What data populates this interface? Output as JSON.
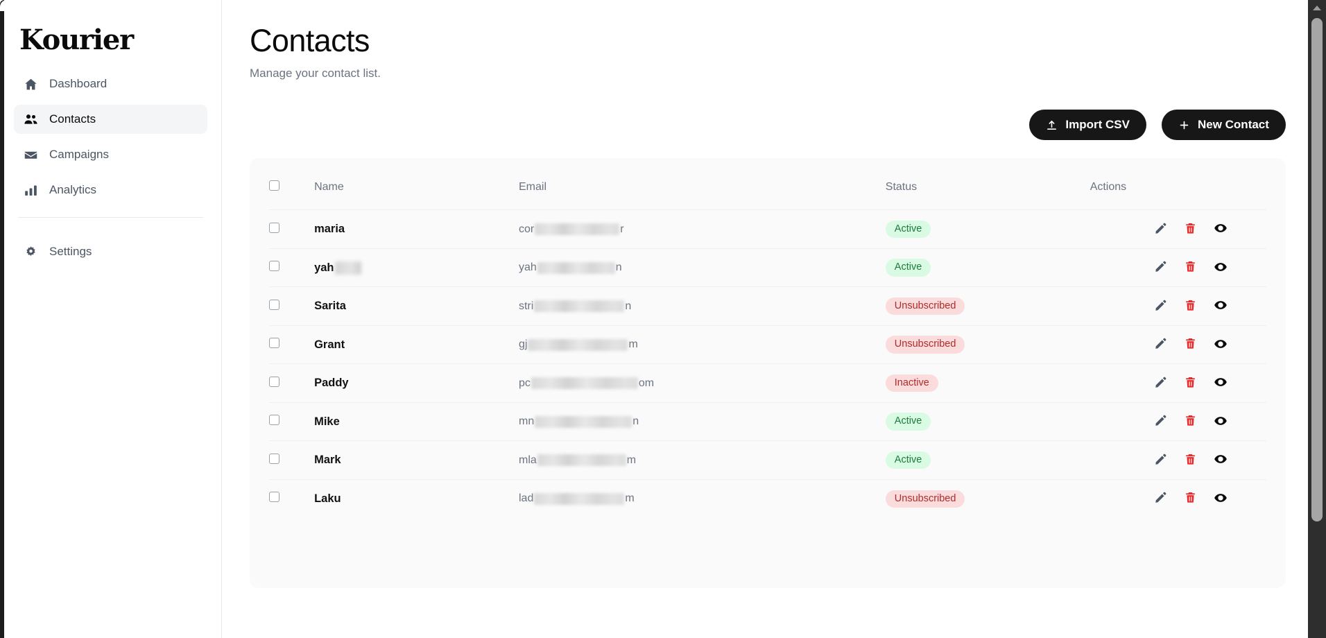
{
  "app": {
    "brand": "Kourier"
  },
  "sidebar": {
    "items": [
      {
        "label": "Dashboard",
        "icon": "home-icon",
        "active": false
      },
      {
        "label": "Contacts",
        "icon": "users-icon",
        "active": true
      },
      {
        "label": "Campaigns",
        "icon": "envelope-icon",
        "active": false
      },
      {
        "label": "Analytics",
        "icon": "bar-chart-icon",
        "active": false
      }
    ],
    "footer_items": [
      {
        "label": "Settings",
        "icon": "gear-icon",
        "active": false
      }
    ]
  },
  "header": {
    "title": "Contacts",
    "subtitle": "Manage your contact list."
  },
  "toolbar": {
    "import_label": "Import CSV",
    "import_icon": "upload-icon",
    "new_contact_label": "New Contact",
    "new_contact_icon": "plus-icon"
  },
  "table": {
    "columns": [
      "Name",
      "Email",
      "Status",
      "Actions"
    ],
    "select_all_checked": false,
    "rows": [
      {
        "name": "maria",
        "name_redacted": false,
        "email_prefix": "cor",
        "email_suffix": "r",
        "email_redacted_width": 122,
        "status": "Active",
        "status_kind": "active"
      },
      {
        "name": "yah",
        "name_redacted": true,
        "email_prefix": "yah",
        "email_suffix": "n",
        "email_redacted_width": 112,
        "status": "Active",
        "status_kind": "active"
      },
      {
        "name": "Sarita",
        "name_redacted": false,
        "email_prefix": "stri",
        "email_suffix": "n",
        "email_redacted_width": 130,
        "status": "Unsubscribed",
        "status_kind": "unsubscribed"
      },
      {
        "name": "Grant",
        "name_redacted": false,
        "email_prefix": "gj",
        "email_suffix": "m",
        "email_redacted_width": 144,
        "status": "Unsubscribed",
        "status_kind": "unsubscribed"
      },
      {
        "name": "Paddy",
        "name_redacted": false,
        "email_prefix": "pc",
        "email_suffix": "om",
        "email_redacted_width": 154,
        "status": "Inactive",
        "status_kind": "inactive"
      },
      {
        "name": "Mike",
        "name_redacted": false,
        "email_prefix": "mn",
        "email_suffix": "n",
        "email_redacted_width": 140,
        "status": "Active",
        "status_kind": "active"
      },
      {
        "name": "Mark",
        "name_redacted": false,
        "email_prefix": "mla",
        "email_suffix": "m",
        "email_redacted_width": 128,
        "status": "Active",
        "status_kind": "active"
      },
      {
        "name": "Laku",
        "name_redacted": false,
        "email_prefix": "lad",
        "email_suffix": "m",
        "email_redacted_width": 130,
        "status": "Unsubscribed",
        "status_kind": "unsubscribed"
      }
    ],
    "row_actions": [
      {
        "name": "edit-contact-button",
        "icon": "pencil-icon"
      },
      {
        "name": "delete-contact-button",
        "icon": "trash-icon"
      },
      {
        "name": "view-contact-button",
        "icon": "eye-icon"
      }
    ]
  },
  "colors": {
    "accent_dark": "#171717",
    "badge_active_bg": "#d9fbe3",
    "badge_active_text": "#1b7a3e",
    "badge_danger_bg": "#fbdcdc",
    "badge_danger_text": "#b02a2a",
    "delete_icon": "#ea2a2a",
    "card_bg": "#fafafa",
    "sidebar_active_bg": "#f4f5f7"
  }
}
